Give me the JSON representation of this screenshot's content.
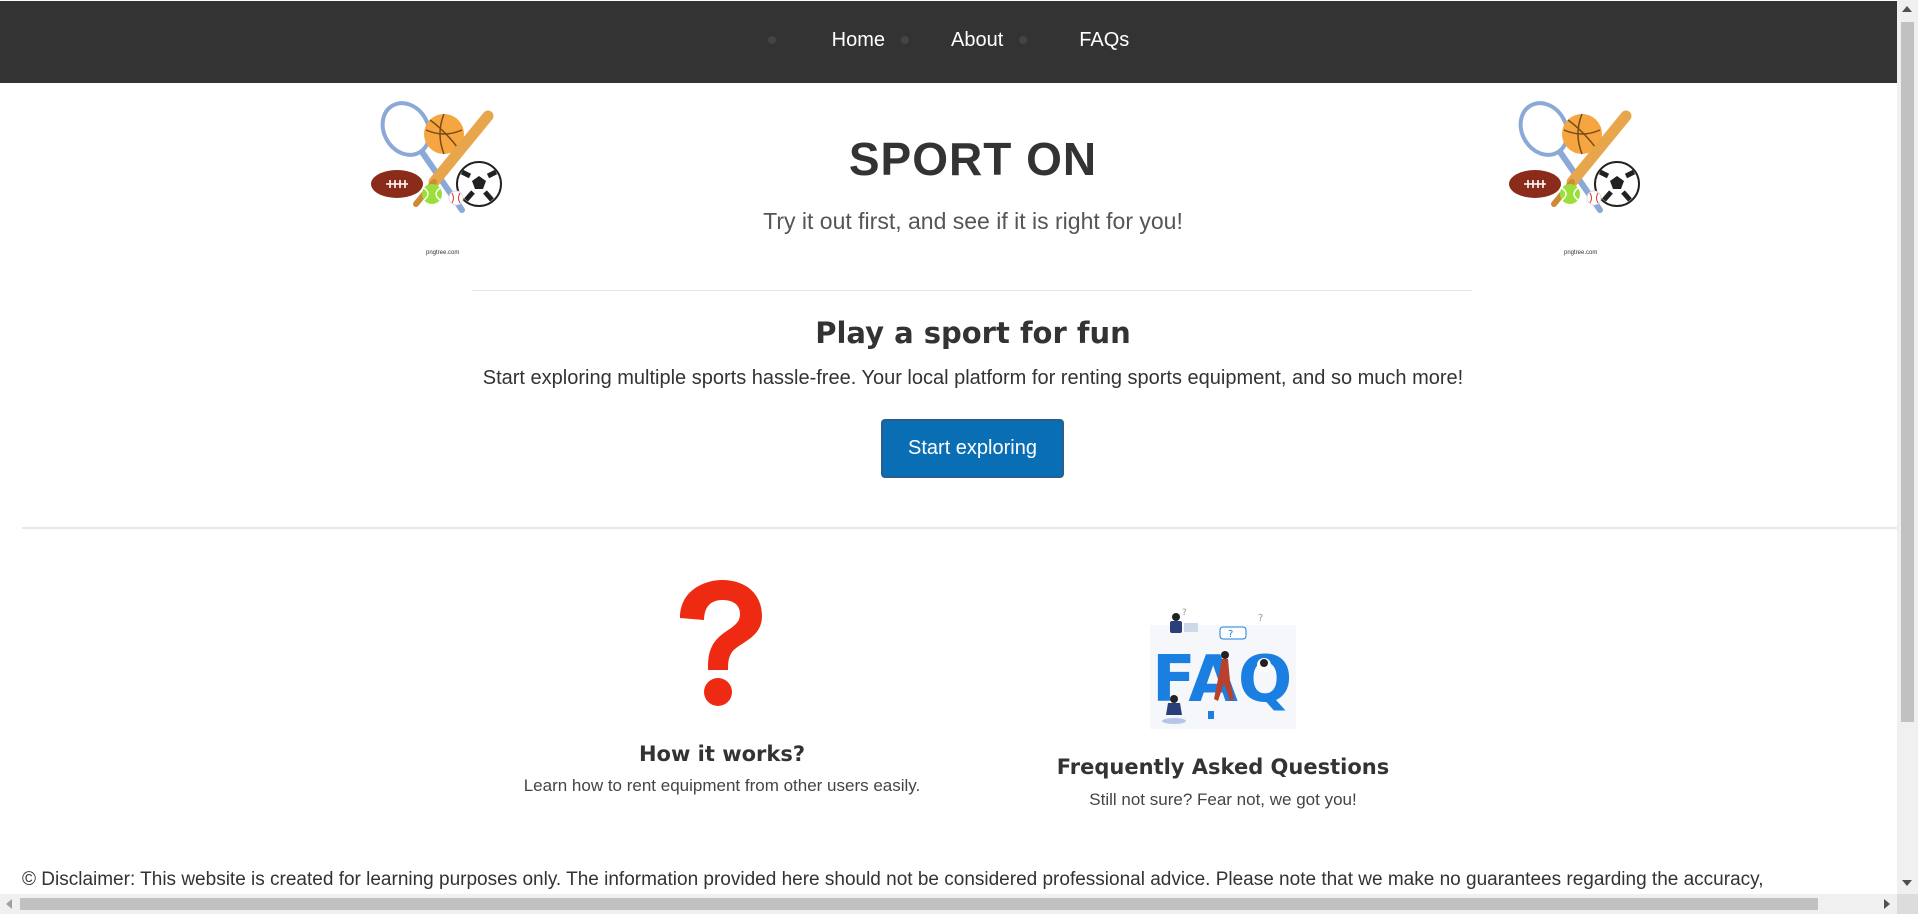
{
  "nav": {
    "items": [
      {
        "label": "Home"
      },
      {
        "label": "About"
      },
      {
        "label": "FAQs"
      }
    ]
  },
  "header": {
    "title": "SPORT ON",
    "tagline": "Try it out first, and see if it is right for you!",
    "image_credit": "pngtree.com"
  },
  "intro": {
    "title": "Play a sport for fun",
    "description": "Start exploring multiple sports hassle-free. Your local platform for renting sports equipment, and so much more!",
    "button_label": "Start exploring"
  },
  "cards": [
    {
      "icon": "question-mark-icon",
      "title": "How it works?",
      "description": "Learn how to rent equipment from other users easily."
    },
    {
      "icon": "faq-illustration",
      "title": "Frequently Asked Questions",
      "description": "Still not sure? Fear not, we got you!"
    }
  ],
  "footer": {
    "disclaimer": "© Disclaimer: This website is created for learning purposes only. The information provided here should not be considered professional advice. Please note that we make no guarantees regarding the accuracy,"
  },
  "colors": {
    "navbar": "#333333",
    "button": "#0a6eb4",
    "question_mark": "#ee2a12",
    "faq_blue": "#1a7fe0"
  }
}
